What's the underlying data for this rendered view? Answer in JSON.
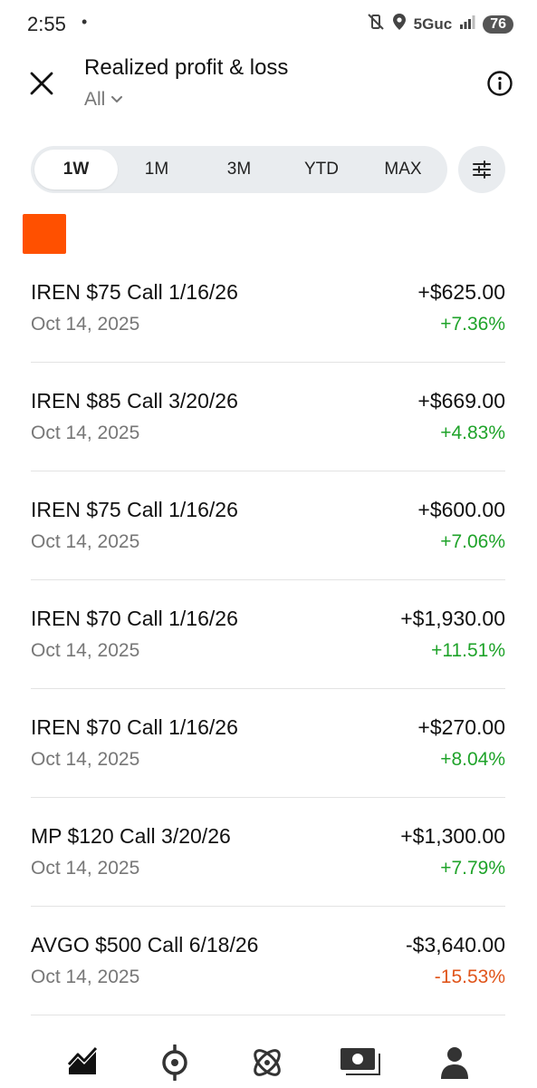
{
  "status_bar": {
    "time": "2:55",
    "dot": "•",
    "network": "5Guc",
    "battery": "76"
  },
  "header": {
    "title": "Realized profit & loss",
    "filter": "All"
  },
  "range_tabs": [
    {
      "label": "1W",
      "active": true
    },
    {
      "label": "1M",
      "active": false
    },
    {
      "label": "3M",
      "active": false
    },
    {
      "label": "YTD",
      "active": false
    },
    {
      "label": "MAX",
      "active": false
    }
  ],
  "accent_color": "#ff5000",
  "gain_color": "#1fa32a",
  "loss_color": "#e0551b",
  "rows": [
    {
      "name": "IREN $75 Call 1/16/26",
      "date": "Oct 14, 2025",
      "amount": "+$625.00",
      "percent": "+7.36%",
      "direction": "gain"
    },
    {
      "name": "IREN $85 Call 3/20/26",
      "date": "Oct 14, 2025",
      "amount": "+$669.00",
      "percent": "+4.83%",
      "direction": "gain"
    },
    {
      "name": "IREN $75 Call 1/16/26",
      "date": "Oct 14, 2025",
      "amount": "+$600.00",
      "percent": "+7.06%",
      "direction": "gain"
    },
    {
      "name": "IREN $70 Call 1/16/26",
      "date": "Oct 14, 2025",
      "amount": "+$1,930.00",
      "percent": "+11.51%",
      "direction": "gain"
    },
    {
      "name": "IREN $70 Call 1/16/26",
      "date": "Oct 14, 2025",
      "amount": "+$270.00",
      "percent": "+8.04%",
      "direction": "gain"
    },
    {
      "name": "MP $120 Call 3/20/26",
      "date": "Oct 14, 2025",
      "amount": "+$1,300.00",
      "percent": "+7.79%",
      "direction": "gain"
    },
    {
      "name": "AVGO $500 Call 6/18/26",
      "date": "Oct 14, 2025",
      "amount": "-$3,640.00",
      "percent": "-15.53%",
      "direction": "loss"
    }
  ],
  "bottom_nav": [
    {
      "icon": "investing-chart-icon"
    },
    {
      "icon": "crypto-icon"
    },
    {
      "icon": "atom-icon"
    },
    {
      "icon": "cash-icon"
    },
    {
      "icon": "account-icon"
    }
  ]
}
